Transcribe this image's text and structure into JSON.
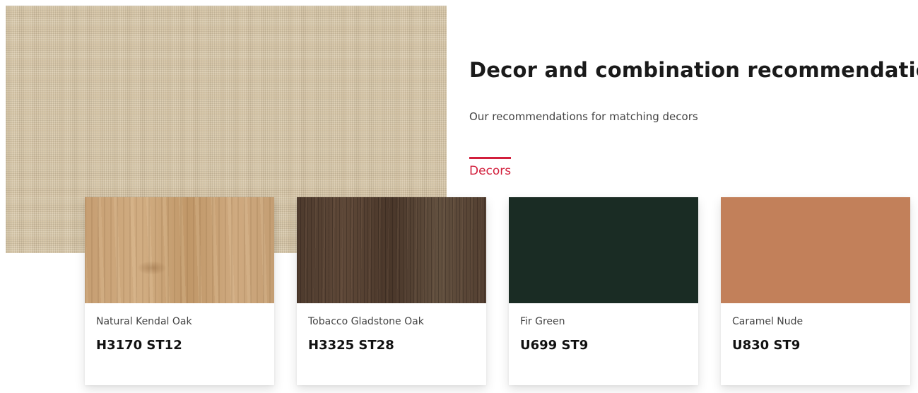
{
  "section": {
    "title": "Decor and combination recommendations",
    "subtitle": "Our recommendations for matching decors",
    "active_tab": "Decors",
    "accent_color": "#d21f3c"
  },
  "hero": {
    "swatch_color": "#d6c5a6"
  },
  "decors": [
    {
      "name": "Natural Kendal Oak",
      "code": "H3170 ST12",
      "swatch_color": "#c9a478"
    },
    {
      "name": "Tobacco Gladstone Oak",
      "code": "H3325 ST28",
      "swatch_color": "#5a4536"
    },
    {
      "name": "Fir Green",
      "code": "U699 ST9",
      "swatch_color": "#1a2c24"
    },
    {
      "name": "Caramel Nude",
      "code": "U830 ST9",
      "swatch_color": "#c2805a"
    }
  ]
}
